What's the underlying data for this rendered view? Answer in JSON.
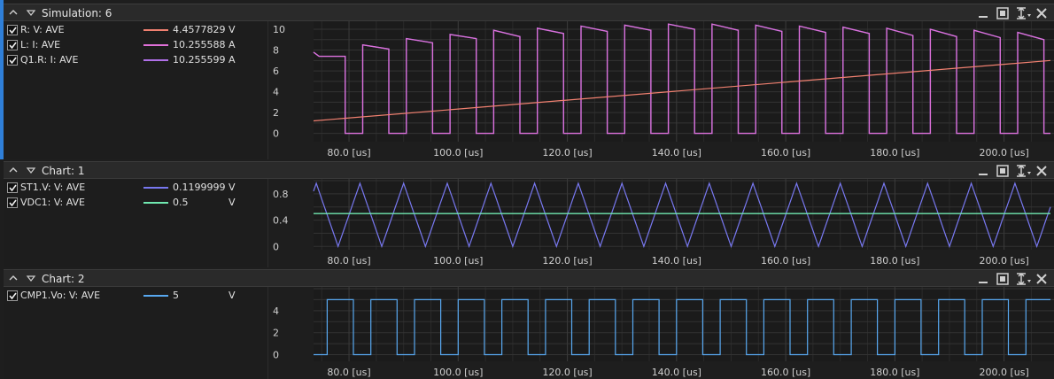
{
  "x_axis": {
    "unit": "[us]",
    "range": [
      73.5,
      208.5
    ],
    "ticks": [
      "80.0",
      "100.0",
      "120.0",
      "140.0",
      "160.0",
      "180.0",
      "200.0"
    ],
    "tick_values": [
      80,
      100,
      120,
      140,
      160,
      180,
      200
    ]
  },
  "panels": [
    {
      "title": "Simulation: 6",
      "signals": [
        {
          "name": "R: V: AVE",
          "value": "4.457782979",
          "unit": "V",
          "color": "#f08070",
          "checked": true
        },
        {
          "name": "L: I: AVE",
          "value": "10.25558808",
          "unit": "A",
          "color": "#e070d8",
          "checked": true
        },
        {
          "name": "Q1.R: I: AVE",
          "value": "10.25559975",
          "unit": "A",
          "color": "#b070e8",
          "checked": true
        }
      ],
      "y_ticks": [
        "0",
        "2",
        "4",
        "6",
        "8",
        "10"
      ],
      "y_tick_values": [
        0,
        2,
        4,
        6,
        8,
        10
      ],
      "ylim": [
        -0.8,
        10.6
      ]
    },
    {
      "title": "Chart: 1",
      "signals": [
        {
          "name": "ST1.V: V: AVE",
          "value": "0.119999999",
          "unit": "V",
          "color": "#7878f0",
          "checked": true
        },
        {
          "name": "VDC1: V: AVE",
          "value": "0.5",
          "unit": "V",
          "color": "#70e8b0",
          "checked": true
        }
      ],
      "y_ticks": [
        "0",
        "0.4",
        "0.8"
      ],
      "y_tick_values": [
        0,
        0.4,
        0.8
      ],
      "ylim": [
        -0.05,
        1.0
      ]
    },
    {
      "title": "Chart: 2",
      "signals": [
        {
          "name": "CMP1.Vo: V: AVE",
          "value": "5",
          "unit": "V",
          "color": "#58a8f0",
          "checked": true
        }
      ],
      "y_ticks": [
        "0",
        "2",
        "4"
      ],
      "y_tick_values": [
        0,
        2,
        4
      ],
      "ylim": [
        -0.6,
        6.0
      ]
    }
  ],
  "chart_data": [
    {
      "type": "line",
      "title": "Simulation: 6",
      "xlabel": "[us]",
      "x_range": [
        73.5,
        208.5
      ],
      "ylim": [
        -0.8,
        10.6
      ],
      "grid": true,
      "series": [
        {
          "name": "R: V: AVE",
          "kind": "ramp",
          "x": [
            73.5,
            208.5
          ],
          "values": [
            1.2,
            7.0
          ]
        },
        {
          "name": "L: I: AVE",
          "kind": "pulsed",
          "period": 8.0,
          "duty": 0.6,
          "start": 74.5,
          "low": 0,
          "peaks_start": [
            7.7,
            8.5,
            9.1,
            9.5,
            9.9,
            10.1,
            10.3,
            10.4,
            10.5,
            10.5,
            10.4,
            10.3,
            10.2,
            10.1,
            10.0,
            9.9,
            9.7
          ],
          "peaks_end": [
            7.4,
            8.1,
            8.7,
            9.1,
            9.3,
            9.6,
            9.8,
            9.9,
            10.0,
            9.9,
            9.8,
            9.7,
            9.6,
            9.4,
            9.3,
            9.2,
            9.0
          ]
        },
        {
          "name": "Q1.R: I: AVE",
          "kind": "pulsed",
          "note_same_as": "L: I: AVE"
        }
      ]
    },
    {
      "type": "line",
      "title": "Chart: 1",
      "xlabel": "[us]",
      "x_range": [
        73.5,
        208.5
      ],
      "ylim": [
        -0.05,
        1.0
      ],
      "grid": true,
      "series": [
        {
          "name": "ST1.V: V: AVE",
          "kind": "triangle",
          "period": 8.0,
          "min": 0.0,
          "max": 0.96,
          "peak_at": 82.0
        },
        {
          "name": "VDC1: V: AVE",
          "kind": "constant",
          "values": [
            0.5
          ]
        }
      ]
    },
    {
      "type": "line",
      "title": "Chart: 2",
      "xlabel": "[us]",
      "x_range": [
        73.5,
        208.5
      ],
      "ylim": [
        -0.6,
        6.0
      ],
      "grid": true,
      "series": [
        {
          "name": "CMP1.Vo: V: AVE",
          "kind": "square",
          "period": 8.0,
          "duty": 0.6,
          "start": 76.0,
          "low": 0,
          "high": 5
        }
      ]
    }
  ]
}
